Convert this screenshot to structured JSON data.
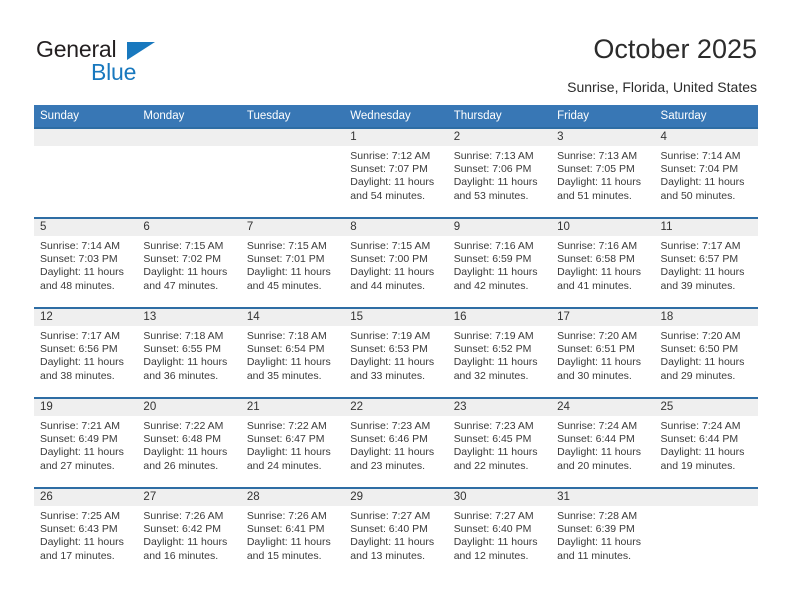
{
  "brand": {
    "name_top": "General",
    "name_bottom": "Blue",
    "accent_color": "#1878be"
  },
  "header": {
    "title": "October 2025",
    "subtitle": "Sunrise, Florida, United States"
  },
  "theme": {
    "header_blue": "#3877b5",
    "row_divider_blue": "#2e6da4",
    "daynum_band": "#efefef",
    "text": "#3a3a3a"
  },
  "calendar": {
    "weekday_headers": [
      "Sunday",
      "Monday",
      "Tuesday",
      "Wednesday",
      "Thursday",
      "Friday",
      "Saturday"
    ],
    "weeks": [
      [
        {
          "day": "",
          "sunrise": "",
          "sunset": "",
          "daylight_line1": "",
          "daylight_line2": ""
        },
        {
          "day": "",
          "sunrise": "",
          "sunset": "",
          "daylight_line1": "",
          "daylight_line2": ""
        },
        {
          "day": "",
          "sunrise": "",
          "sunset": "",
          "daylight_line1": "",
          "daylight_line2": ""
        },
        {
          "day": "1",
          "sunrise": "Sunrise: 7:12 AM",
          "sunset": "Sunset: 7:07 PM",
          "daylight_line1": "Daylight: 11 hours",
          "daylight_line2": "and 54 minutes."
        },
        {
          "day": "2",
          "sunrise": "Sunrise: 7:13 AM",
          "sunset": "Sunset: 7:06 PM",
          "daylight_line1": "Daylight: 11 hours",
          "daylight_line2": "and 53 minutes."
        },
        {
          "day": "3",
          "sunrise": "Sunrise: 7:13 AM",
          "sunset": "Sunset: 7:05 PM",
          "daylight_line1": "Daylight: 11 hours",
          "daylight_line2": "and 51 minutes."
        },
        {
          "day": "4",
          "sunrise": "Sunrise: 7:14 AM",
          "sunset": "Sunset: 7:04 PM",
          "daylight_line1": "Daylight: 11 hours",
          "daylight_line2": "and 50 minutes."
        }
      ],
      [
        {
          "day": "5",
          "sunrise": "Sunrise: 7:14 AM",
          "sunset": "Sunset: 7:03 PM",
          "daylight_line1": "Daylight: 11 hours",
          "daylight_line2": "and 48 minutes."
        },
        {
          "day": "6",
          "sunrise": "Sunrise: 7:15 AM",
          "sunset": "Sunset: 7:02 PM",
          "daylight_line1": "Daylight: 11 hours",
          "daylight_line2": "and 47 minutes."
        },
        {
          "day": "7",
          "sunrise": "Sunrise: 7:15 AM",
          "sunset": "Sunset: 7:01 PM",
          "daylight_line1": "Daylight: 11 hours",
          "daylight_line2": "and 45 minutes."
        },
        {
          "day": "8",
          "sunrise": "Sunrise: 7:15 AM",
          "sunset": "Sunset: 7:00 PM",
          "daylight_line1": "Daylight: 11 hours",
          "daylight_line2": "and 44 minutes."
        },
        {
          "day": "9",
          "sunrise": "Sunrise: 7:16 AM",
          "sunset": "Sunset: 6:59 PM",
          "daylight_line1": "Daylight: 11 hours",
          "daylight_line2": "and 42 minutes."
        },
        {
          "day": "10",
          "sunrise": "Sunrise: 7:16 AM",
          "sunset": "Sunset: 6:58 PM",
          "daylight_line1": "Daylight: 11 hours",
          "daylight_line2": "and 41 minutes."
        },
        {
          "day": "11",
          "sunrise": "Sunrise: 7:17 AM",
          "sunset": "Sunset: 6:57 PM",
          "daylight_line1": "Daylight: 11 hours",
          "daylight_line2": "and 39 minutes."
        }
      ],
      [
        {
          "day": "12",
          "sunrise": "Sunrise: 7:17 AM",
          "sunset": "Sunset: 6:56 PM",
          "daylight_line1": "Daylight: 11 hours",
          "daylight_line2": "and 38 minutes."
        },
        {
          "day": "13",
          "sunrise": "Sunrise: 7:18 AM",
          "sunset": "Sunset: 6:55 PM",
          "daylight_line1": "Daylight: 11 hours",
          "daylight_line2": "and 36 minutes."
        },
        {
          "day": "14",
          "sunrise": "Sunrise: 7:18 AM",
          "sunset": "Sunset: 6:54 PM",
          "daylight_line1": "Daylight: 11 hours",
          "daylight_line2": "and 35 minutes."
        },
        {
          "day": "15",
          "sunrise": "Sunrise: 7:19 AM",
          "sunset": "Sunset: 6:53 PM",
          "daylight_line1": "Daylight: 11 hours",
          "daylight_line2": "and 33 minutes."
        },
        {
          "day": "16",
          "sunrise": "Sunrise: 7:19 AM",
          "sunset": "Sunset: 6:52 PM",
          "daylight_line1": "Daylight: 11 hours",
          "daylight_line2": "and 32 minutes."
        },
        {
          "day": "17",
          "sunrise": "Sunrise: 7:20 AM",
          "sunset": "Sunset: 6:51 PM",
          "daylight_line1": "Daylight: 11 hours",
          "daylight_line2": "and 30 minutes."
        },
        {
          "day": "18",
          "sunrise": "Sunrise: 7:20 AM",
          "sunset": "Sunset: 6:50 PM",
          "daylight_line1": "Daylight: 11 hours",
          "daylight_line2": "and 29 minutes."
        }
      ],
      [
        {
          "day": "19",
          "sunrise": "Sunrise: 7:21 AM",
          "sunset": "Sunset: 6:49 PM",
          "daylight_line1": "Daylight: 11 hours",
          "daylight_line2": "and 27 minutes."
        },
        {
          "day": "20",
          "sunrise": "Sunrise: 7:22 AM",
          "sunset": "Sunset: 6:48 PM",
          "daylight_line1": "Daylight: 11 hours",
          "daylight_line2": "and 26 minutes."
        },
        {
          "day": "21",
          "sunrise": "Sunrise: 7:22 AM",
          "sunset": "Sunset: 6:47 PM",
          "daylight_line1": "Daylight: 11 hours",
          "daylight_line2": "and 24 minutes."
        },
        {
          "day": "22",
          "sunrise": "Sunrise: 7:23 AM",
          "sunset": "Sunset: 6:46 PM",
          "daylight_line1": "Daylight: 11 hours",
          "daylight_line2": "and 23 minutes."
        },
        {
          "day": "23",
          "sunrise": "Sunrise: 7:23 AM",
          "sunset": "Sunset: 6:45 PM",
          "daylight_line1": "Daylight: 11 hours",
          "daylight_line2": "and 22 minutes."
        },
        {
          "day": "24",
          "sunrise": "Sunrise: 7:24 AM",
          "sunset": "Sunset: 6:44 PM",
          "daylight_line1": "Daylight: 11 hours",
          "daylight_line2": "and 20 minutes."
        },
        {
          "day": "25",
          "sunrise": "Sunrise: 7:24 AM",
          "sunset": "Sunset: 6:44 PM",
          "daylight_line1": "Daylight: 11 hours",
          "daylight_line2": "and 19 minutes."
        }
      ],
      [
        {
          "day": "26",
          "sunrise": "Sunrise: 7:25 AM",
          "sunset": "Sunset: 6:43 PM",
          "daylight_line1": "Daylight: 11 hours",
          "daylight_line2": "and 17 minutes."
        },
        {
          "day": "27",
          "sunrise": "Sunrise: 7:26 AM",
          "sunset": "Sunset: 6:42 PM",
          "daylight_line1": "Daylight: 11 hours",
          "daylight_line2": "and 16 minutes."
        },
        {
          "day": "28",
          "sunrise": "Sunrise: 7:26 AM",
          "sunset": "Sunset: 6:41 PM",
          "daylight_line1": "Daylight: 11 hours",
          "daylight_line2": "and 15 minutes."
        },
        {
          "day": "29",
          "sunrise": "Sunrise: 7:27 AM",
          "sunset": "Sunset: 6:40 PM",
          "daylight_line1": "Daylight: 11 hours",
          "daylight_line2": "and 13 minutes."
        },
        {
          "day": "30",
          "sunrise": "Sunrise: 7:27 AM",
          "sunset": "Sunset: 6:40 PM",
          "daylight_line1": "Daylight: 11 hours",
          "daylight_line2": "and 12 minutes."
        },
        {
          "day": "31",
          "sunrise": "Sunrise: 7:28 AM",
          "sunset": "Sunset: 6:39 PM",
          "daylight_line1": "Daylight: 11 hours",
          "daylight_line2": "and 11 minutes."
        },
        {
          "day": "",
          "sunrise": "",
          "sunset": "",
          "daylight_line1": "",
          "daylight_line2": ""
        }
      ]
    ]
  }
}
